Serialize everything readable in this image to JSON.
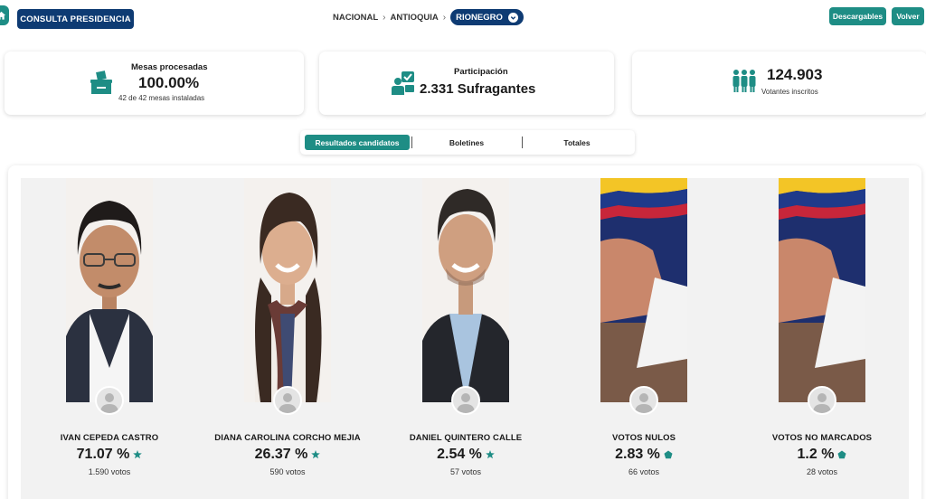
{
  "header": {
    "consulta_label": "CONSULTA PRESIDENCIA",
    "breadcrumb": [
      "NACIONAL",
      "ANTIOQUIA"
    ],
    "breadcrumb_current": "RIONEGRO",
    "descargables_label": "Descargables",
    "volver_label": "Volver"
  },
  "stats": {
    "mesas": {
      "title": "Mesas procesadas",
      "value": "100.00%",
      "sub": "42 de 42 mesas instaladas"
    },
    "participacion": {
      "title": "Participación",
      "value": "2.331 Sufragantes"
    },
    "inscritos": {
      "value": "124.903",
      "sub": "Votantes inscritos"
    }
  },
  "tabs": [
    "Resultados candidatos",
    "Boletines",
    "Totales"
  ],
  "active_tab": "Resultados candidatos",
  "candidates": [
    {
      "name": "IVAN CEPEDA CASTRO",
      "pct": "71.07 %",
      "votes": "1.590 votos",
      "badge": "star-icon"
    },
    {
      "name": "DIANA CAROLINA CORCHO MEJIA",
      "pct": "26.37 %",
      "votes": "590 votos",
      "badge": "star-icon"
    },
    {
      "name": "DANIEL QUINTERO CALLE",
      "pct": "2.54 %",
      "votes": "57 votos",
      "badge": "star-icon"
    },
    {
      "name": "VOTOS NULOS",
      "pct": "2.83 %",
      "votes": "66 votos",
      "badge": "pentagon-icon"
    },
    {
      "name": "VOTOS NO MARCADOS",
      "pct": "1.2 %",
      "votes": "28 votos",
      "badge": "pentagon-icon"
    }
  ],
  "colors": {
    "teal": "#1e8d85",
    "navy": "#0e3b73",
    "badge_green": "#1e8d85"
  }
}
